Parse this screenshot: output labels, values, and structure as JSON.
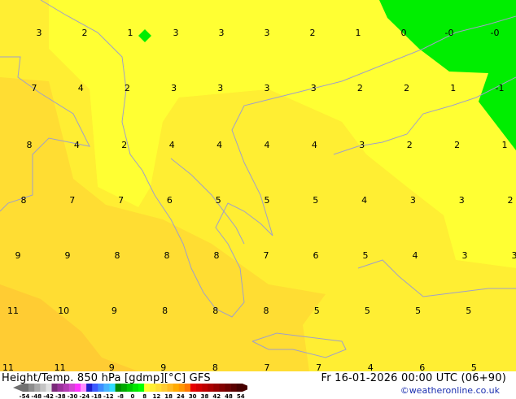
{
  "map": {
    "field": "Height/Temp. 850 hPa",
    "colors": {
      "yellow": "#ffff33",
      "light_yellow_orange": "#ffee33",
      "yellow_orange": "#ffdd33",
      "orange": "#ffcc33",
      "green": "#00ee00",
      "coastline": "#a0a0c8"
    },
    "value_rows": [
      [
        "3",
        "2",
        "1",
        "3",
        "3",
        "3",
        "2",
        "1",
        "0",
        "-0",
        "-0"
      ],
      [
        "7",
        "4",
        "2",
        "3",
        "3",
        "3",
        "3",
        "2",
        "2",
        "1",
        "-1"
      ],
      [
        "8",
        "4",
        "2",
        "4",
        "4",
        "4",
        "4",
        "3",
        "2",
        "2",
        "1"
      ],
      [
        "8",
        "7",
        "7",
        "6",
        "5",
        "5",
        "5",
        "4",
        "3",
        "3",
        "2"
      ],
      [
        "9",
        "9",
        "8",
        "8",
        "8",
        "7",
        "6",
        "5",
        "4",
        "3",
        "3"
      ],
      [
        "11",
        "10",
        "9",
        "8",
        "8",
        "8",
        "5",
        "5",
        "5",
        "5"
      ],
      [
        "11",
        "11",
        "9",
        "9",
        "8",
        "7",
        "7",
        "4",
        "6",
        "5"
      ]
    ]
  },
  "footer": {
    "title": "Height/Temp. 850 hPa [gdmp][°C] GFS",
    "datetime": "Fr 16-01-2026 00:00 UTC (06+90)",
    "credit": "©weatheronline.co.uk",
    "colorbar": {
      "colors": [
        "#707070",
        "#8c8c8c",
        "#a8a8a8",
        "#c4c4c4",
        "#e0e0e0",
        "#7a2a7a",
        "#9a329a",
        "#b43cb4",
        "#d246d2",
        "#ff32ff",
        "#ff8cff",
        "#1e1ecc",
        "#3c5aff",
        "#3c8cff",
        "#46b4ff",
        "#32dcff",
        "#008c00",
        "#00aa00",
        "#00c800",
        "#00e600",
        "#00ff00",
        "#ffff32",
        "#ffee32",
        "#ffdd32",
        "#ffcc32",
        "#ffbb22",
        "#ffaa00",
        "#ff9600",
        "#ff7800",
        "#e60000",
        "#d20000",
        "#be0000",
        "#aa0000",
        "#960000",
        "#820000",
        "#6e0000",
        "#5a0000",
        "#460000"
      ],
      "labels": [
        "-54",
        "-48",
        "-42",
        "-38",
        "-30",
        "-24",
        "-18",
        "-12",
        "-8",
        "0",
        "8",
        "12",
        "18",
        "24",
        "30",
        "38",
        "42",
        "48",
        "54"
      ]
    }
  }
}
